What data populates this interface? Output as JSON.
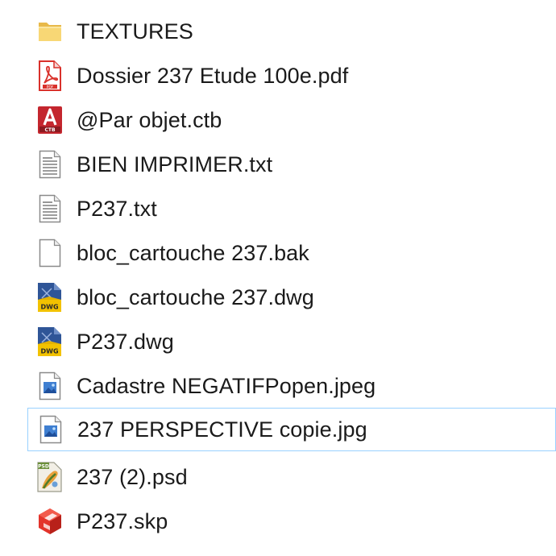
{
  "files": [
    {
      "name": "TEXTURES",
      "icon": "folder-icon",
      "selected": false
    },
    {
      "name": "Dossier 237 Etude 100e.pdf",
      "icon": "pdf-file-icon",
      "selected": false
    },
    {
      "name": "@Par objet.ctb",
      "icon": "autocad-ctb-file-icon",
      "selected": false
    },
    {
      "name": "BIEN IMPRIMER.txt",
      "icon": "text-file-icon",
      "selected": false
    },
    {
      "name": "P237.txt",
      "icon": "text-file-icon",
      "selected": false
    },
    {
      "name": "bloc_cartouche 237.bak",
      "icon": "generic-file-icon",
      "selected": false
    },
    {
      "name": "bloc_cartouche 237.dwg",
      "icon": "dwg-file-icon",
      "selected": false
    },
    {
      "name": "P237.dwg",
      "icon": "dwg-file-icon",
      "selected": false
    },
    {
      "name": "Cadastre NEGATIFPopen.jpeg",
      "icon": "image-file-icon",
      "selected": false
    },
    {
      "name": "237 PERSPECTIVE copie.jpg",
      "icon": "image-file-icon",
      "selected": true
    },
    {
      "name": "237 (2).psd",
      "icon": "psd-file-icon",
      "selected": false
    },
    {
      "name": "P237.skp",
      "icon": "sketchup-file-icon",
      "selected": false
    }
  ],
  "colors": {
    "selection_border": "#99d1ff",
    "folder": "#f8d775",
    "pdf_red": "#d9312b",
    "dwg_blue": "#2f5597",
    "dwg_yellow": "#f2c200",
    "image_blue": "#3f7fd1",
    "skp_red": "#e3342b"
  }
}
